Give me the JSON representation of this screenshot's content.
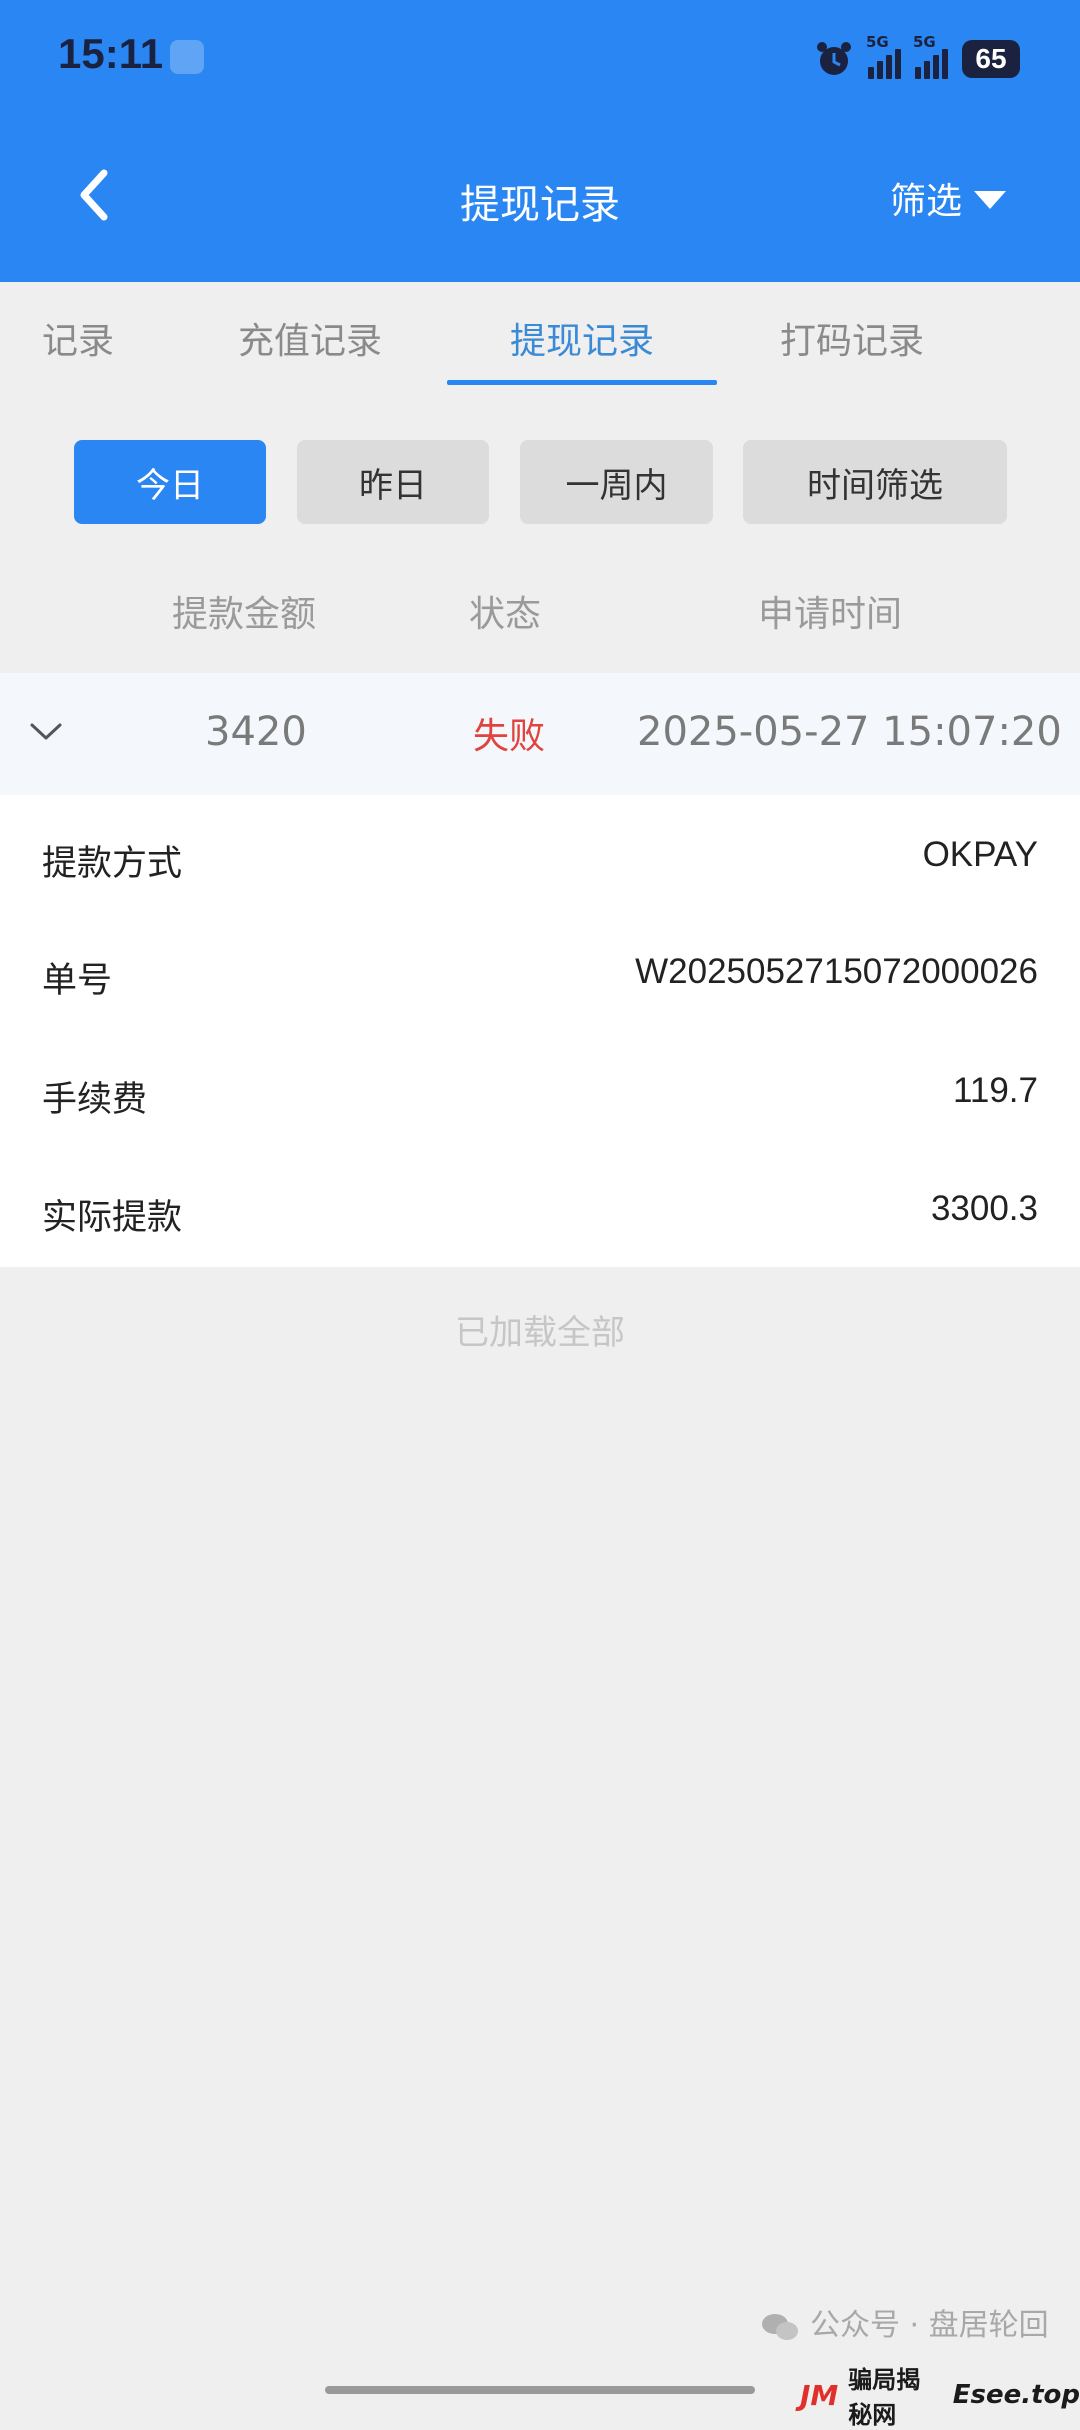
{
  "status_bar": {
    "time": "15:11",
    "signal1_label": "5G",
    "signal2_label": "5G",
    "battery": "65"
  },
  "header": {
    "title": "提现记录",
    "filter_label": "筛选",
    "back_icon": "chevron-left-icon"
  },
  "tabs": [
    {
      "label": "记录"
    },
    {
      "label": "充值记录"
    },
    {
      "label": "提现记录",
      "active": true
    },
    {
      "label": "打码记录"
    }
  ],
  "date_filters": [
    {
      "label": "今日",
      "active": true
    },
    {
      "label": "昨日"
    },
    {
      "label": "一周内"
    },
    {
      "label": "时间筛选"
    }
  ],
  "columns": [
    "提款金额",
    "状态",
    "申请时间"
  ],
  "record": {
    "amount": "3420",
    "status": "失败",
    "time": "2025-05-27 15:07:20"
  },
  "details": [
    {
      "label": "提款方式",
      "value": "OKPAY"
    },
    {
      "label": "单号",
      "value": "W2025052715072000026"
    },
    {
      "label": "手续费",
      "value": "119.7"
    },
    {
      "label": "实际提款",
      "value": "3300.3"
    }
  ],
  "footer": {
    "loaded_all": "已加载全部"
  },
  "watermark": {
    "line1": "公众号 · 盘居轮回",
    "logo": "JM",
    "brand": "骗局揭秘网",
    "site": "Esee.top"
  },
  "colors": {
    "primary": "#2a86f2",
    "fail": "#e0443d",
    "background": "#efefef"
  }
}
